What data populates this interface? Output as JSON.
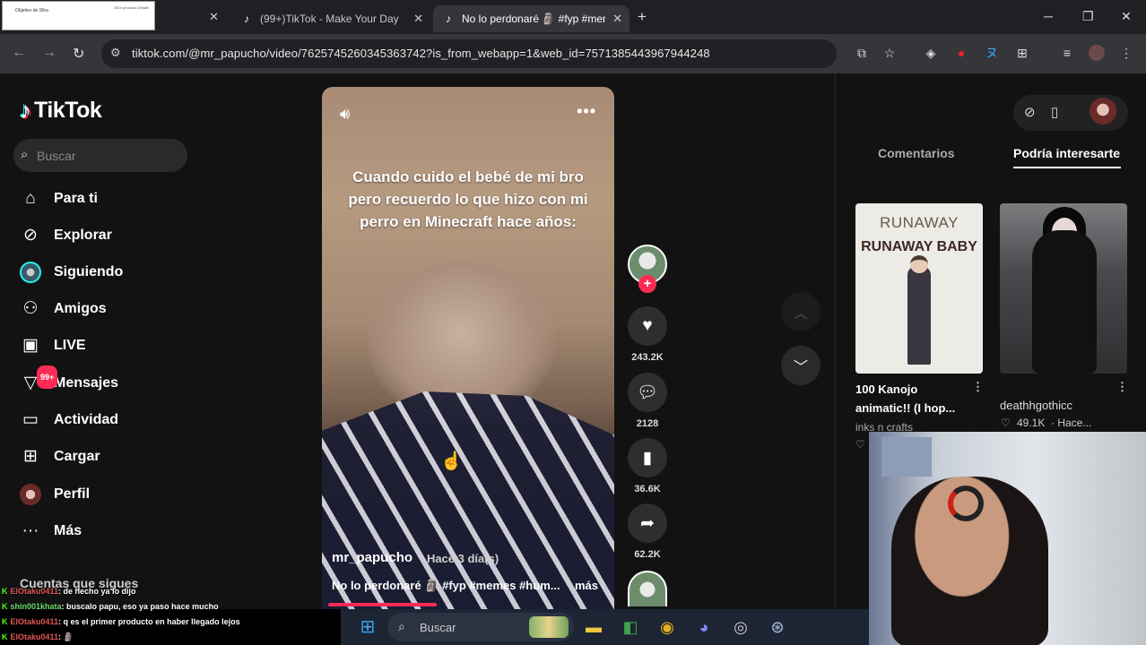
{
  "browser": {
    "tabs": [
      {
        "title": "",
        "active": false
      },
      {
        "title": "(99+)TikTok - Make Your Day",
        "active": false
      },
      {
        "title": "No lo perdonaré 🗿 #fyp #mer",
        "active": true
      }
    ],
    "thumbnail_text": "Objetivo de Sfira",
    "thumbnail_small": "2024 producto\nDetalle",
    "url": "tiktok.com/@mr_papucho/video/7625745260345363742?is_from_webapp=1&web_id=7571385443967944248",
    "new_tab": "+",
    "close": "✕",
    "minimize": "─",
    "maximize": "❐",
    "window_close": "✕"
  },
  "sidebar": {
    "brand": "TikTok",
    "search_placeholder": "Buscar",
    "items": [
      {
        "label": "Para ti",
        "icon": "home-icon"
      },
      {
        "label": "Explorar",
        "icon": "compass-icon"
      },
      {
        "label": "Siguiendo",
        "icon": "following-avatar-icon"
      },
      {
        "label": "Amigos",
        "icon": "friends-icon"
      },
      {
        "label": "LIVE",
        "icon": "live-tv-icon"
      },
      {
        "label": "Mensajes",
        "icon": "messages-icon",
        "badge": "99+"
      },
      {
        "label": "Actividad",
        "icon": "activity-icon"
      },
      {
        "label": "Cargar",
        "icon": "upload-icon"
      },
      {
        "label": "Perfil",
        "icon": "profile-avatar-icon"
      },
      {
        "label": "Más",
        "icon": "more-icon"
      }
    ],
    "following_title": "Cuentas que sigues"
  },
  "video": {
    "caption": "Cuando cuido el bebé de mi bro pero recuerdo lo que hizo con mi perro en Minecraft hace años:",
    "author": "mr_papucho",
    "time": "· Hace 3 día(s)",
    "description": "No lo perdonaré 🗿 #fyp #memes #hum...",
    "more": "más",
    "progress": 0.37
  },
  "actions": {
    "likes": "243.2K",
    "comments": "2128",
    "saves": "36.6K",
    "shares": "62.2K"
  },
  "right_panel": {
    "tabs": [
      "Comentarios",
      "Podría interesarte"
    ],
    "active_tab": 1,
    "cards": [
      {
        "title": "100 Kanojo animatic!! (I hop...",
        "author": "inks n crafts",
        "thumb_line1": "RUNAWAY",
        "thumb_line2": "RUNAWAY BABY"
      },
      {
        "title": "deathhgothicc",
        "likes": "49.1K",
        "time": "· Hace..."
      }
    ]
  },
  "chat": [
    {
      "user": "ElOtaku0411",
      "msg": ": de hecho ya lo dijo",
      "color": "u1"
    },
    {
      "user": "shin001khata",
      "msg": ": buscalo papu, eso ya paso hace mucho",
      "color": "u2"
    },
    {
      "user": "ElOtaku0411",
      "msg": ": q es el primer producto en haber llegado lejos",
      "color": "u1"
    },
    {
      "user": "ElOtaku0411",
      "msg": ": 🗿",
      "color": "u1"
    }
  ],
  "taskbar": {
    "search": "Buscar"
  },
  "colors": {
    "accent": "#fe2c55",
    "background": "#121212"
  }
}
